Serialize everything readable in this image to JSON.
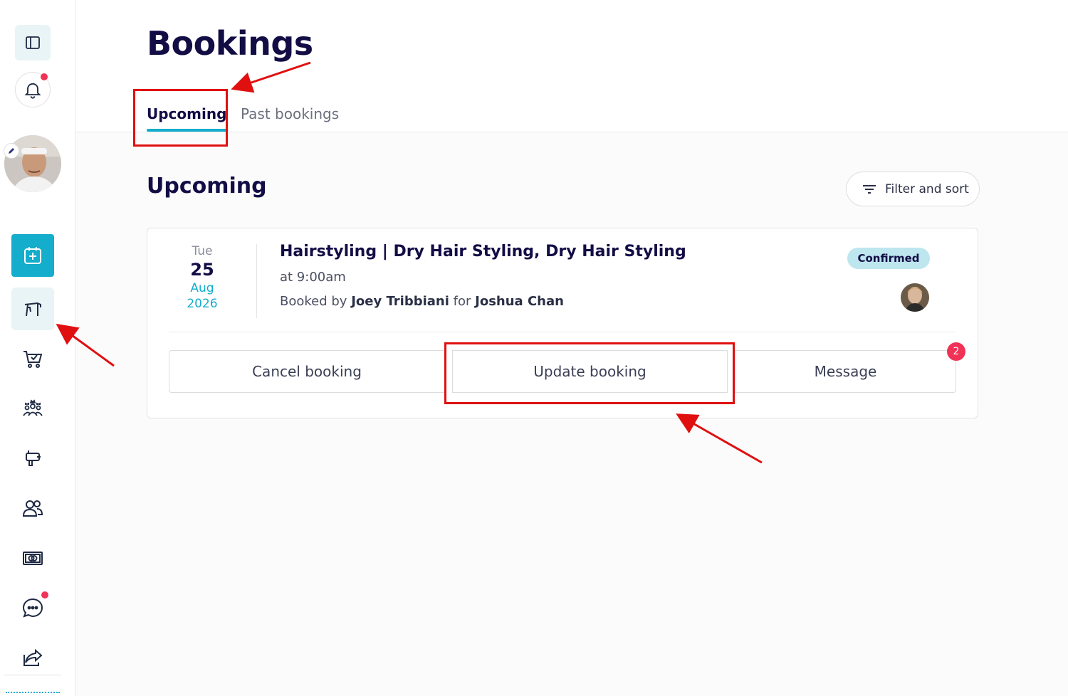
{
  "header": {
    "title": "Bookings",
    "tabs": [
      {
        "label": "Upcoming",
        "active": true
      },
      {
        "label": "Past bookings",
        "active": false
      }
    ]
  },
  "sidebar": {
    "items": [
      {
        "name": "sidebar-toggle",
        "icon": "sidebar-panel-icon"
      },
      {
        "name": "notifications",
        "icon": "bell-icon",
        "has_dot": true
      },
      {
        "name": "profile-avatar",
        "icon": "pencil-icon"
      },
      {
        "name": "bookings",
        "icon": "calendar-plus-icon",
        "active": true
      },
      {
        "name": "services",
        "icon": "salon-chair-icon"
      },
      {
        "name": "shop",
        "icon": "cart-check-icon"
      },
      {
        "name": "team",
        "icon": "crowned-group-icon"
      },
      {
        "name": "equipment",
        "icon": "hair-dryer-icon"
      },
      {
        "name": "clients",
        "icon": "people-icon"
      },
      {
        "name": "payments",
        "icon": "money-icon"
      },
      {
        "name": "messages",
        "icon": "chat-bubble-icon",
        "has_dot": true
      },
      {
        "name": "share",
        "icon": "share-icon"
      }
    ]
  },
  "main": {
    "section_title": "Upcoming",
    "filter_label": "Filter and sort",
    "booking": {
      "day_of_week": "Tue",
      "day": "25",
      "month": "Aug",
      "year": "2026",
      "title": "Hairstyling | Dry Hair Styling, Dry Hair Styling",
      "time": "at 9:00am",
      "booked_by_prefix": "Booked by",
      "booked_by": "Joey Tribbiani",
      "for_word": "for",
      "client": "Joshua Chan",
      "status": "Confirmed",
      "actions": {
        "cancel": "Cancel booking",
        "update": "Update booking",
        "message": "Message",
        "message_count": "2"
      }
    }
  },
  "colors": {
    "accent": "#14adcc",
    "navy": "#120d45",
    "badge_bg": "#bde6ef",
    "notification": "#f03256",
    "annotation": "#e01010"
  }
}
